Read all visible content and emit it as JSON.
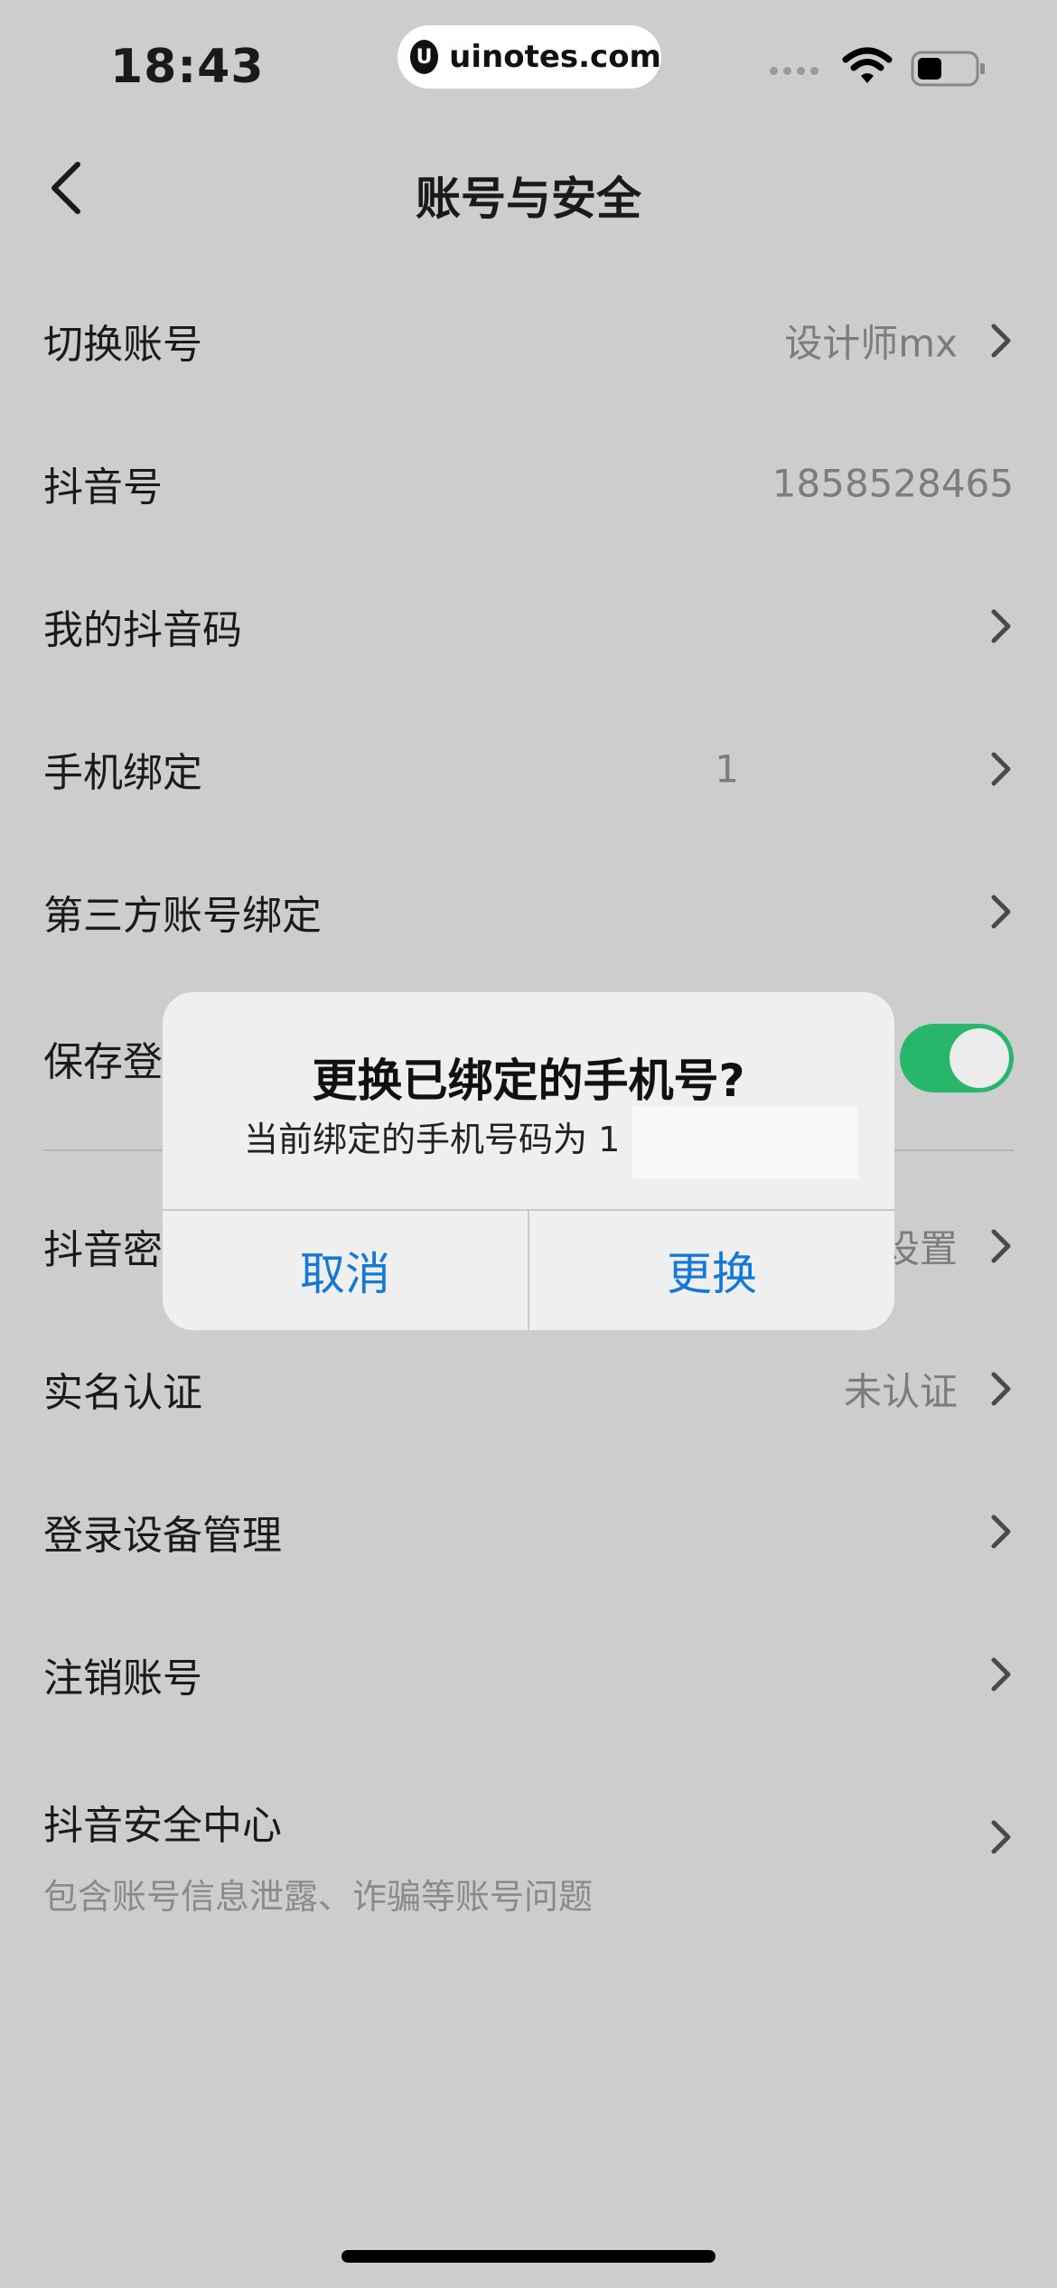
{
  "status_bar": {
    "time": "18:43",
    "watermark": "uinotes.com",
    "watermark_logo": "U"
  },
  "nav": {
    "title": "账号与安全"
  },
  "rows": [
    {
      "label": "切换账号",
      "value": "设计师mx"
    },
    {
      "label": "抖音号",
      "value": "1858528465"
    },
    {
      "label": "我的抖音码",
      "value": ""
    },
    {
      "label": "手机绑定",
      "value": "1"
    },
    {
      "label": "第三方账号绑定",
      "value": ""
    },
    {
      "label": "保存登",
      "value": ""
    },
    {
      "label": "抖音密",
      "value": "设置"
    },
    {
      "label": "实名认证",
      "value": "未认证"
    },
    {
      "label": "登录设备管理",
      "value": ""
    },
    {
      "label": "注销账号",
      "value": ""
    },
    {
      "label": "抖音安全中心",
      "value": "",
      "sub": "包含账号信息泄露、诈骗等账号问题"
    }
  ],
  "toggle": {
    "on": true
  },
  "dialog": {
    "title": "更换已绑定的手机号?",
    "message": "当前绑定的手机号码为 1",
    "cancel": "取消",
    "confirm": "更换"
  },
  "colors": {
    "background": "#cdcdcd",
    "accent_blue": "#1478d6",
    "toggle_green": "#27b66a"
  }
}
